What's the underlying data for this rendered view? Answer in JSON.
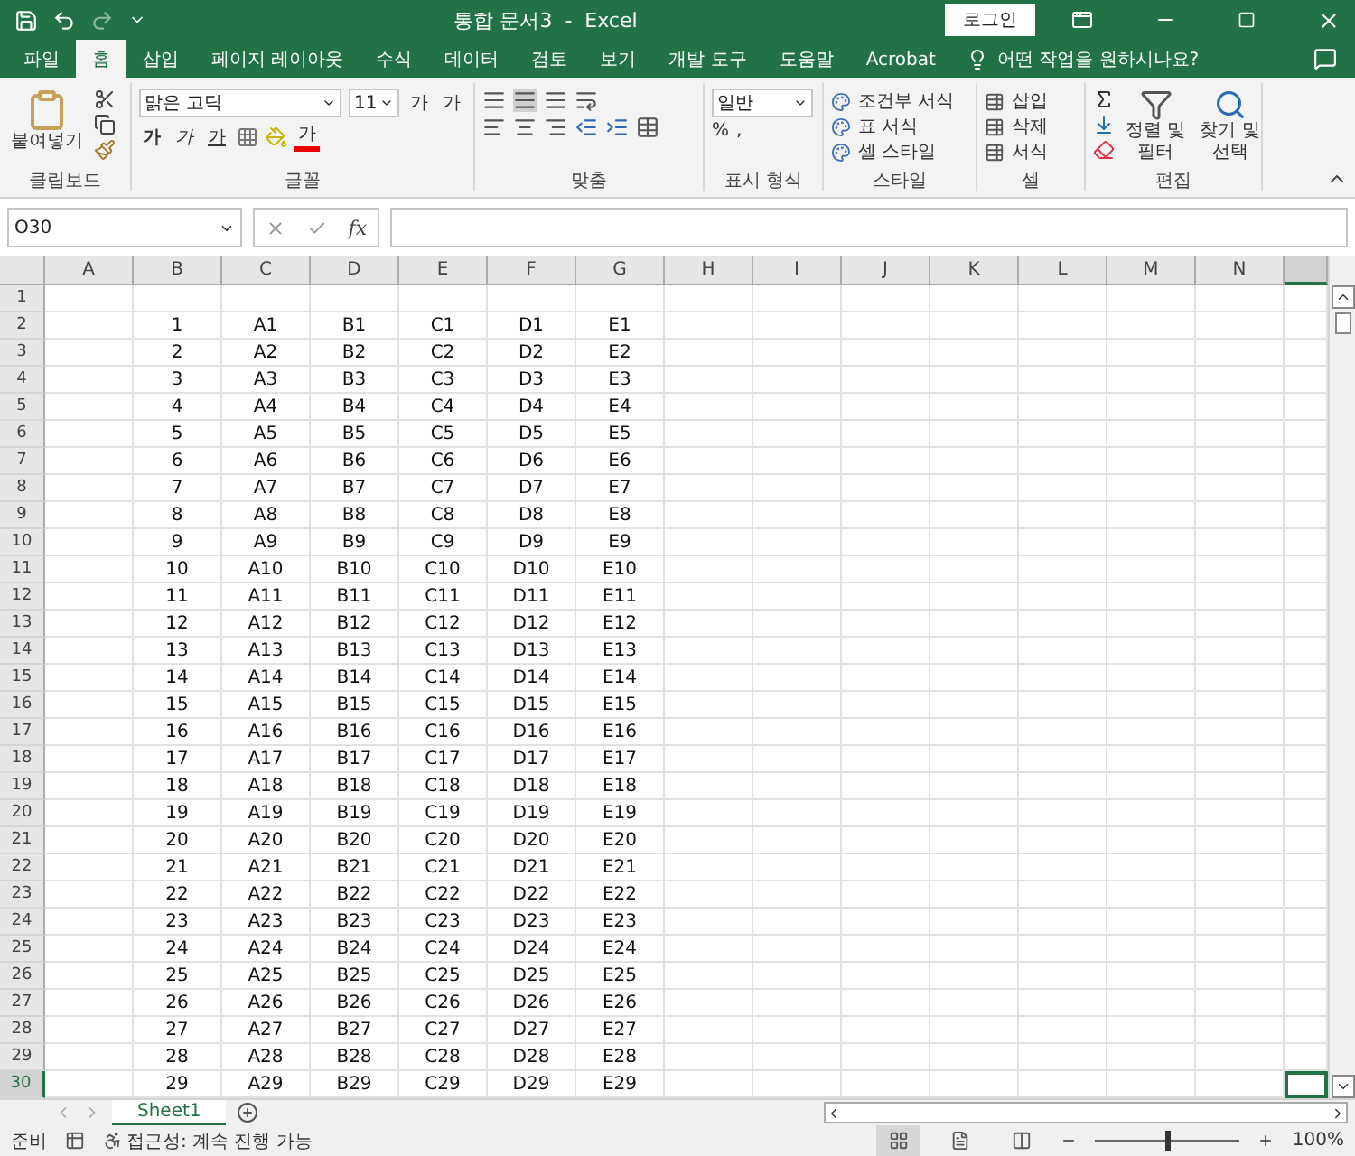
{
  "window": {
    "title": "통합 문서3  -  Excel",
    "login": "로그인"
  },
  "menu_tabs": [
    {
      "label": "파일",
      "selected": false
    },
    {
      "label": "홈",
      "selected": true
    },
    {
      "label": "삽입",
      "selected": false
    },
    {
      "label": "페이지 레이아웃",
      "selected": false
    },
    {
      "label": "수식",
      "selected": false
    },
    {
      "label": "데이터",
      "selected": false
    },
    {
      "label": "검토",
      "selected": false
    },
    {
      "label": "보기",
      "selected": false
    },
    {
      "label": "개발 도구",
      "selected": false
    },
    {
      "label": "도움말",
      "selected": false
    },
    {
      "label": "Acrobat",
      "selected": false
    }
  ],
  "tell_me": "어떤 작업을 원하시나요?",
  "ribbon": {
    "clipboard": {
      "label": "클립보드",
      "paste": "붙여넣기"
    },
    "font": {
      "label": "글꼴",
      "font_name": "맑은 고딕",
      "font_size": "11",
      "grow": "가",
      "shrink": "가",
      "styles": [
        {
          "kind": "bold",
          "glyph": "가"
        },
        {
          "kind": "italic",
          "glyph": "가"
        },
        {
          "kind": "underline",
          "glyph": "가"
        }
      ],
      "font_color_glyph": "가"
    },
    "alignment": {
      "label": "맞춤"
    },
    "number": {
      "label": "표시 형식",
      "format": "일반",
      "percent": "%",
      "comma": ","
    },
    "styles": {
      "label": "스타일",
      "items": [
        "조건부 서식",
        "표 서식",
        "셀 스타일"
      ]
    },
    "cells": {
      "label": "셀",
      "items": [
        "삽입",
        "삭제",
        "서식"
      ]
    },
    "editing": {
      "label": "편집",
      "sort": [
        "정렬 및",
        "필터"
      ],
      "find": [
        "찾기 및",
        "선택"
      ]
    }
  },
  "formula_bar": {
    "name_box": "O30",
    "function_button": "fx"
  },
  "columns": [
    {
      "label": "A",
      "selected": false
    },
    {
      "label": "B",
      "selected": false
    },
    {
      "label": "C",
      "selected": false
    },
    {
      "label": "D",
      "selected": false
    },
    {
      "label": "E",
      "selected": false
    },
    {
      "label": "F",
      "selected": false
    },
    {
      "label": "G",
      "selected": false
    },
    {
      "label": "H",
      "selected": false
    },
    {
      "label": "I",
      "selected": false
    },
    {
      "label": "J",
      "selected": false
    },
    {
      "label": "K",
      "selected": false
    },
    {
      "label": "L",
      "selected": false
    },
    {
      "label": "M",
      "selected": false
    },
    {
      "label": "N",
      "selected": false
    },
    {
      "selected": true
    }
  ],
  "rows": [
    {
      "label": "1",
      "selected": false,
      "cells": {}
    },
    {
      "label": "2",
      "selected": false,
      "cells": {
        "B": "1",
        "C": "A1",
        "D": "B1",
        "E": "C1",
        "F": "D1",
        "G": "E1"
      }
    },
    {
      "label": "3",
      "selected": false,
      "cells": {
        "B": "2",
        "C": "A2",
        "D": "B2",
        "E": "C2",
        "F": "D2",
        "G": "E2"
      }
    },
    {
      "label": "4",
      "selected": false,
      "cells": {
        "B": "3",
        "C": "A3",
        "D": "B3",
        "E": "C3",
        "F": "D3",
        "G": "E3"
      }
    },
    {
      "label": "5",
      "selected": false,
      "cells": {
        "B": "4",
        "C": "A4",
        "D": "B4",
        "E": "C4",
        "F": "D4",
        "G": "E4"
      }
    },
    {
      "label": "6",
      "selected": false,
      "cells": {
        "B": "5",
        "C": "A5",
        "D": "B5",
        "E": "C5",
        "F": "D5",
        "G": "E5"
      }
    },
    {
      "label": "7",
      "selected": false,
      "cells": {
        "B": "6",
        "C": "A6",
        "D": "B6",
        "E": "C6",
        "F": "D6",
        "G": "E6"
      }
    },
    {
      "label": "8",
      "selected": false,
      "cells": {
        "B": "7",
        "C": "A7",
        "D": "B7",
        "E": "C7",
        "F": "D7",
        "G": "E7"
      }
    },
    {
      "label": "9",
      "selected": false,
      "cells": {
        "B": "8",
        "C": "A8",
        "D": "B8",
        "E": "C8",
        "F": "D8",
        "G": "E8"
      }
    },
    {
      "label": "10",
      "selected": false,
      "cells": {
        "B": "9",
        "C": "A9",
        "D": "B9",
        "E": "C9",
        "F": "D9",
        "G": "E9"
      }
    },
    {
      "label": "11",
      "selected": false,
      "cells": {
        "B": "10",
        "C": "A10",
        "D": "B10",
        "E": "C10",
        "F": "D10",
        "G": "E10"
      }
    },
    {
      "label": "12",
      "selected": false,
      "cells": {
        "B": "11",
        "C": "A11",
        "D": "B11",
        "E": "C11",
        "F": "D11",
        "G": "E11"
      }
    },
    {
      "label": "13",
      "selected": false,
      "cells": {
        "B": "12",
        "C": "A12",
        "D": "B12",
        "E": "C12",
        "F": "D12",
        "G": "E12"
      }
    },
    {
      "label": "14",
      "selected": false,
      "cells": {
        "B": "13",
        "C": "A13",
        "D": "B13",
        "E": "C13",
        "F": "D13",
        "G": "E13"
      }
    },
    {
      "label": "15",
      "selected": false,
      "cells": {
        "B": "14",
        "C": "A14",
        "D": "B14",
        "E": "C14",
        "F": "D14",
        "G": "E14"
      }
    },
    {
      "label": "16",
      "selected": false,
      "cells": {
        "B": "15",
        "C": "A15",
        "D": "B15",
        "E": "C15",
        "F": "D15",
        "G": "E15"
      }
    },
    {
      "label": "17",
      "selected": false,
      "cells": {
        "B": "16",
        "C": "A16",
        "D": "B16",
        "E": "C16",
        "F": "D16",
        "G": "E16"
      }
    },
    {
      "label": "18",
      "selected": false,
      "cells": {
        "B": "17",
        "C": "A17",
        "D": "B17",
        "E": "C17",
        "F": "D17",
        "G": "E17"
      }
    },
    {
      "label": "19",
      "selected": false,
      "cells": {
        "B": "18",
        "C": "A18",
        "D": "B18",
        "E": "C18",
        "F": "D18",
        "G": "E18"
      }
    },
    {
      "label": "20",
      "selected": false,
      "cells": {
        "B": "19",
        "C": "A19",
        "D": "B19",
        "E": "C19",
        "F": "D19",
        "G": "E19"
      }
    },
    {
      "label": "21",
      "selected": false,
      "cells": {
        "B": "20",
        "C": "A20",
        "D": "B20",
        "E": "C20",
        "F": "D20",
        "G": "E20"
      }
    },
    {
      "label": "22",
      "selected": false,
      "cells": {
        "B": "21",
        "C": "A21",
        "D": "B21",
        "E": "C21",
        "F": "D21",
        "G": "E21"
      }
    },
    {
      "label": "23",
      "selected": false,
      "cells": {
        "B": "22",
        "C": "A22",
        "D": "B22",
        "E": "C22",
        "F": "D22",
        "G": "E22"
      }
    },
    {
      "label": "24",
      "selected": false,
      "cells": {
        "B": "23",
        "C": "A23",
        "D": "B23",
        "E": "C23",
        "F": "D23",
        "G": "E23"
      }
    },
    {
      "label": "25",
      "selected": false,
      "cells": {
        "B": "24",
        "C": "A24",
        "D": "B24",
        "E": "C24",
        "F": "D24",
        "G": "E24"
      }
    },
    {
      "label": "26",
      "selected": false,
      "cells": {
        "B": "25",
        "C": "A25",
        "D": "B25",
        "E": "C25",
        "F": "D25",
        "G": "E25"
      }
    },
    {
      "label": "27",
      "selected": false,
      "cells": {
        "B": "26",
        "C": "A26",
        "D": "B26",
        "E": "C26",
        "F": "D26",
        "G": "E26"
      }
    },
    {
      "label": "28",
      "selected": false,
      "cells": {
        "B": "27",
        "C": "A27",
        "D": "B27",
        "E": "C27",
        "F": "D27",
        "G": "E27"
      }
    },
    {
      "label": "29",
      "selected": false,
      "cells": {
        "B": "28",
        "C": "A28",
        "D": "B28",
        "E": "C28",
        "F": "D28",
        "G": "E28"
      }
    },
    {
      "label": "30",
      "selected": true,
      "cells": {
        "B": "29",
        "C": "A29",
        "D": "B29",
        "E": "C29",
        "F": "D29",
        "G": "E29"
      }
    }
  ],
  "sheet_tabs": [
    {
      "label": "Sheet1",
      "selected": true
    }
  ],
  "status_bar": {
    "ready": "준비",
    "accessibility": "접근성: 계속 진행 가능",
    "views": [
      {
        "kind": "normal",
        "selected": true
      },
      {
        "kind": "page_layout",
        "selected": false
      },
      {
        "kind": "page_break",
        "selected": false
      }
    ],
    "zoom": {
      "level": 0.5,
      "reading": "100%"
    }
  }
}
